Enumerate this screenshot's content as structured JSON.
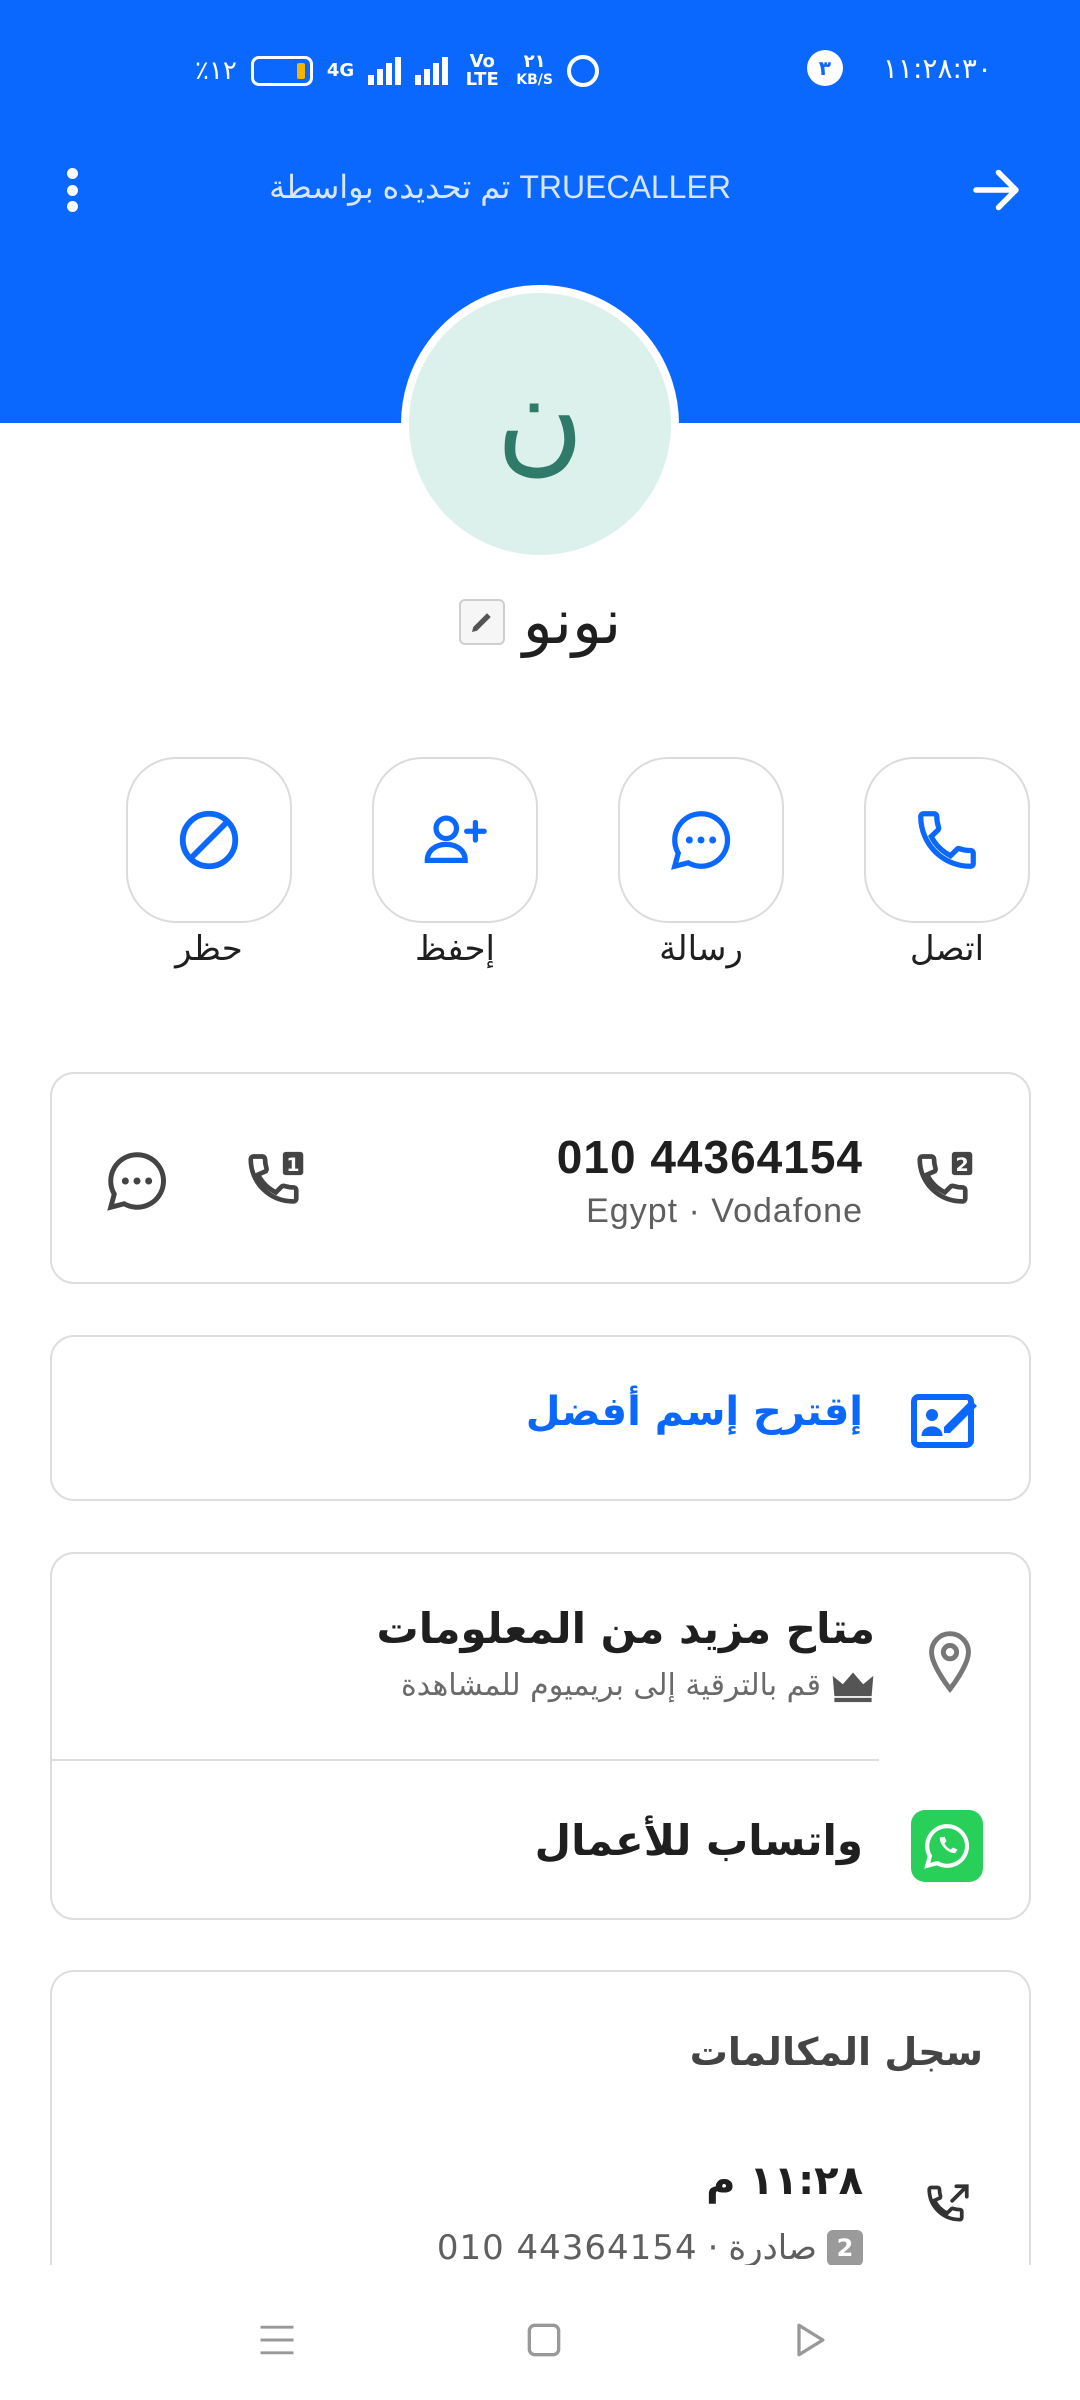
{
  "status_bar": {
    "battery": "٪١٢",
    "network": "4G",
    "volte": "Vo LTE",
    "speed_value": "٢١",
    "speed_unit": "KB/S",
    "notification_count": "٣",
    "time": "١١:٢٨:٣٠"
  },
  "header": {
    "caller_id_text": "تم تحديده بواسطة TRUECALLER",
    "menu_icon": "more-vert-icon",
    "back_icon": "arrow-right-icon",
    "background": "#0a68ff"
  },
  "contact": {
    "initial": "ن",
    "name": "نونو"
  },
  "actions": [
    {
      "label": "اتصل",
      "icon": "phone-icon"
    },
    {
      "label": "رسالة",
      "icon": "chat-icon"
    },
    {
      "label": "إحفظ",
      "icon": "add-person-icon"
    },
    {
      "label": "حظر",
      "icon": "block-icon"
    }
  ],
  "phone": {
    "number": "010 44364154",
    "meta": "Egypt · Vodafone",
    "sim1": "1",
    "sim2": "2"
  },
  "suggest": {
    "label": "إقترح إسم أفضل"
  },
  "info": {
    "more_title": "متاح مزيد من المعلومات",
    "premium_text": "قم بالترقية إلى بريميوم للمشاهدة",
    "whatsapp_label": "واتساب للأعمال"
  },
  "history": {
    "title": "سجل المكالمات",
    "entries": [
      {
        "time": "١١:٢٨ م",
        "type": "صادرة",
        "sim": "2",
        "number": "010 44364154"
      }
    ]
  },
  "colors": {
    "accent": "#0a68ff",
    "whatsapp": "#28d05a",
    "avatar_bg": "#dcf0ec"
  }
}
